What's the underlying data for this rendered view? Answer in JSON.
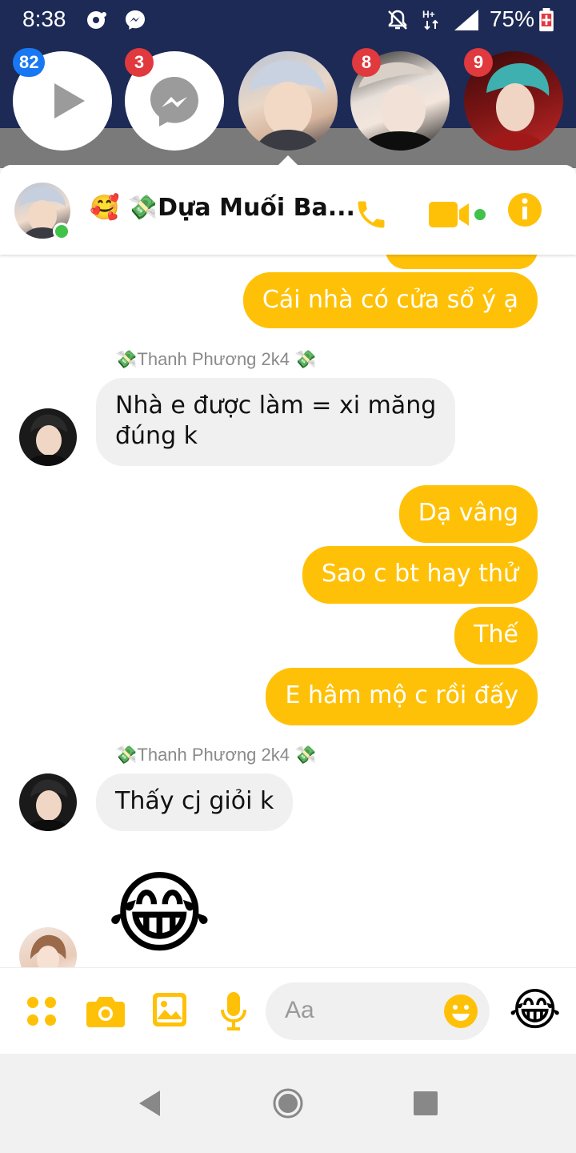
{
  "status_bar": {
    "time": "8:38",
    "battery": "75%"
  },
  "chat_heads": [
    {
      "name": "video-head",
      "badge": "82"
    },
    {
      "name": "messenger-head",
      "badge": "3"
    },
    {
      "name": "active-contact-head",
      "badge": ""
    },
    {
      "name": "contact-head-2",
      "badge": "8"
    },
    {
      "name": "contact-head-3",
      "badge": "9"
    }
  ],
  "header": {
    "title": "🥰 💸Dựa Muối Ba...",
    "icons": [
      "phone-icon",
      "video-camera-icon",
      "info-icon"
    ]
  },
  "messages": [
    {
      "type": "out",
      "text": "Cái nhà có cửa sổ ý ạ"
    },
    {
      "type": "sender",
      "text": "💸Thanh Phương 2k4 💸"
    },
    {
      "type": "in",
      "line1": "Nhà e được làm = xi măng",
      "line2": "đúng k"
    },
    {
      "type": "out",
      "text": "Dạ vâng"
    },
    {
      "type": "out",
      "text": "Sao c bt hay thử"
    },
    {
      "type": "out",
      "text": "Thế"
    },
    {
      "type": "out",
      "text": "E hâm mộ c rồi đấy"
    },
    {
      "type": "sender",
      "text": "💸Thanh Phương 2k4 💸"
    },
    {
      "type": "in",
      "text": "Thấy cj giỏi k"
    },
    {
      "type": "emoji",
      "text": "😂"
    }
  ],
  "composer": {
    "placeholder": "Aa",
    "quick_reaction": "😂"
  },
  "colors": {
    "accent": "#ffc107",
    "status_bar": "#1d2a55",
    "incoming_bubble": "#f0f0f0"
  }
}
